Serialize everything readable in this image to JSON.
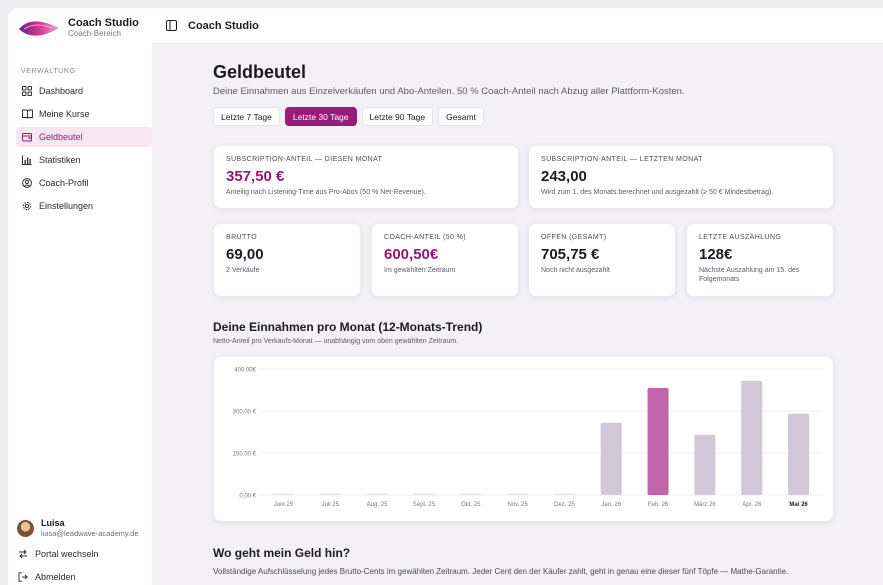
{
  "brand": {
    "title": "Coach Studio",
    "subtitle": "Coach-Bereich"
  },
  "sidebar": {
    "section_label": "VERWALTUNG",
    "items": [
      {
        "label": "Dashboard",
        "icon": "grid-icon"
      },
      {
        "label": "Meine Kurse",
        "icon": "book-icon"
      },
      {
        "label": "Geldbeutel",
        "icon": "wallet-icon",
        "active": true
      },
      {
        "label": "Statistiken",
        "icon": "bar-chart-icon"
      },
      {
        "label": "Coach-Profil",
        "icon": "user-circle-icon"
      },
      {
        "label": "Einstellungen",
        "icon": "gear-icon"
      }
    ],
    "user": {
      "name": "Luisa",
      "email": "luisa@leadwave-academy.de"
    },
    "switch_portal": "Portal wechseln",
    "logout": "Abmelden"
  },
  "topbar": {
    "title": "Coach Studio"
  },
  "page": {
    "title": "Geldbeutel",
    "subtitle": "Deine Einnahmen aus Einzelverkäufen und Abo-Anteilen. 50 % Coach-Anteil nach Abzug aller Plattform-Kosten."
  },
  "filters": [
    {
      "label": "Letzte 7 Tage",
      "active": false
    },
    {
      "label": "Letzte 30 Tage",
      "active": true
    },
    {
      "label": "Letzte 90 Tage",
      "active": false
    },
    {
      "label": "Gesamt",
      "active": false
    }
  ],
  "cards": {
    "sub_this": {
      "label": "SUBSCRIPTION-ANTEIL — DIESEN MONAT",
      "value": "357,50 €",
      "note": "Anteilig nach Listening-Time aus Pro-Abos (50 % Net-Revenue)."
    },
    "sub_last": {
      "label": "SUBSCRIPTION-ANTEIL — LETZTEN MONAT",
      "value": "243,00",
      "note": "Wird zum 1. des Monats berechnet und ausgezahlt (≥ 50 € Mindestbetrag)."
    },
    "brutto": {
      "label": "BRUTTO",
      "value": "69,00",
      "note": "2 Verkäufe"
    },
    "coach": {
      "label": "COACH-ANTEIL (50 %)",
      "value": "600,50€",
      "note": "Im gewählten Zeitraum"
    },
    "offen": {
      "label": "OFFEN (GESAMT)",
      "value": "705,75 €",
      "note": "Noch nicht ausgezahlt"
    },
    "payout": {
      "label": "LETZTE AUSZAHLUNG",
      "value": "128€",
      "note": "Nächste Auszahlung am 15. des Folgemonats"
    }
  },
  "trend": {
    "title": "Deine Einnahmen pro Monat (12-Monats-Trend)",
    "subtitle": "Netto-Anteil pro Verkaufs-Monat — unabhängig vom oben gewählten Zeitraum."
  },
  "chart_data": {
    "type": "bar",
    "categories": [
      "Juni 25",
      "Juli 25",
      "Aug. 25",
      "Sept. 25",
      "Okt. 25",
      "Nov. 25",
      "Dez. 25",
      "Jan. 26",
      "Feb. 26",
      "März 26",
      "Apr. 26",
      "Mai 26"
    ],
    "values": [
      0,
      0,
      0,
      0,
      0,
      0,
      0,
      258,
      382,
      215,
      408,
      290
    ],
    "y_ticks": [
      "0,00 €",
      "150,00 €",
      "300,00 €",
      "400,00€"
    ],
    "y_tick_values": [
      0,
      150,
      300,
      450
    ],
    "ylim": [
      0,
      450
    ],
    "grid": true,
    "highlight_index": 8,
    "bold_label_index": 11,
    "colors": {
      "bar": "#d2c9d8",
      "highlight": "#c166ab",
      "zero": "#e8e4ec"
    }
  },
  "geld": {
    "title": "Wo geht mein Geld hin?",
    "subtitle": "Vollständige Aufschlüsselung jedes Brutto-Cents im gewählten Zeitraum. Jeder Cent den der Käufer zahlt, geht in genau eine dieser fünf Töpfe — Mathe-Garantie."
  }
}
